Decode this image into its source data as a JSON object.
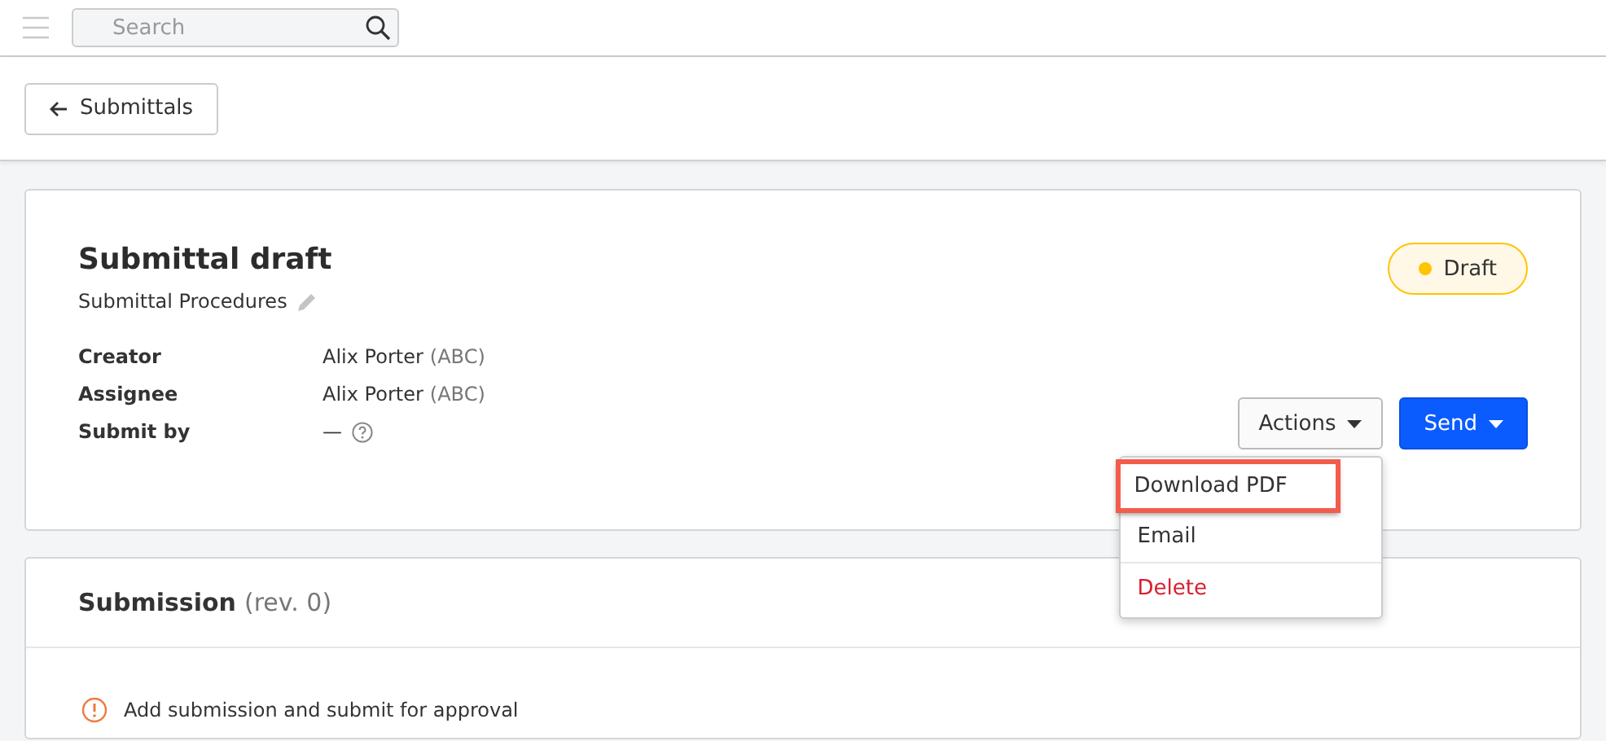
{
  "search": {
    "placeholder": "Search"
  },
  "back_button": {
    "label": "Submittals"
  },
  "submittal": {
    "title": "Submittal draft",
    "subtitle": "Submittal Procedures",
    "status": {
      "label": "Draft",
      "color": "#ffc400"
    },
    "details": [
      {
        "label": "Creator",
        "value": "Alix Porter",
        "org": "(ABC)"
      },
      {
        "label": "Assignee",
        "value": "Alix Porter",
        "org": "(ABC)"
      },
      {
        "label": "Submit by",
        "value": "—",
        "help": true
      }
    ],
    "actions_button": {
      "label": "Actions",
      "expanded": true
    },
    "send_button": {
      "label": "Send"
    },
    "actions_menu": [
      {
        "label": "Download PDF",
        "kind": "normal",
        "highlighted": true
      },
      {
        "label": "Email",
        "kind": "normal",
        "highlighted": false
      },
      {
        "label": "Delete",
        "kind": "danger",
        "highlighted": false
      }
    ]
  },
  "submission": {
    "title": "Submission",
    "revision": "(rev. 0)",
    "notice": "Add submission and submit for approval"
  }
}
